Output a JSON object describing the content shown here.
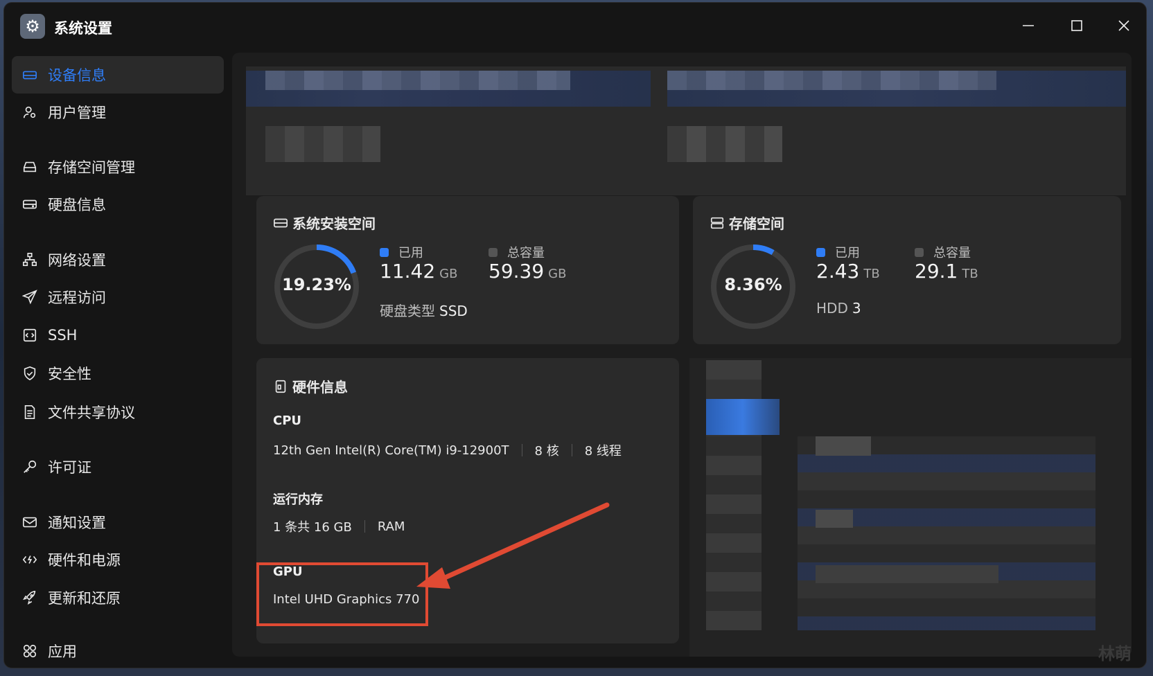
{
  "window": {
    "title": "系统设置"
  },
  "icons": {
    "app": "gear-icon",
    "minimize": "minimize-icon",
    "maximize": "maximize-icon",
    "close": "close-icon"
  },
  "sidebar": {
    "items": [
      {
        "label": "设备信息",
        "icon": "device-icon",
        "active": true
      },
      {
        "label": "用户管理",
        "icon": "user-icon"
      },
      {
        "label": "存储空间管理",
        "icon": "storage-icon"
      },
      {
        "label": "硬盘信息",
        "icon": "disk-icon"
      },
      {
        "label": "网络设置",
        "icon": "network-icon"
      },
      {
        "label": "远程访问",
        "icon": "send-icon"
      },
      {
        "label": "SSH",
        "icon": "ssh-icon"
      },
      {
        "label": "安全性",
        "icon": "shield-icon"
      },
      {
        "label": "文件共享协议",
        "icon": "file-icon"
      },
      {
        "label": "许可证",
        "icon": "key-icon"
      },
      {
        "label": "通知设置",
        "icon": "mail-icon"
      },
      {
        "label": "硬件和电源",
        "icon": "power-icon"
      },
      {
        "label": "更新和还原",
        "icon": "rocket-icon"
      },
      {
        "label": "应用",
        "icon": "apps-icon"
      }
    ]
  },
  "system_space": {
    "title": "系统安装空间",
    "percent_text": "19.23%",
    "percent": 19.23,
    "used_label": "已用",
    "used_value": "11.42",
    "used_unit": "GB",
    "total_label": "总容量",
    "total_value": "59.39",
    "total_unit": "GB",
    "disk_type_label": "硬盘类型",
    "disk_type_value": "SSD"
  },
  "storage_space": {
    "title": "存储空间",
    "percent_text": "8.36%",
    "percent": 8.36,
    "used_label": "已用",
    "used_value": "2.43",
    "used_unit": "TB",
    "total_label": "总容量",
    "total_value": "29.1",
    "total_unit": "TB",
    "disk_type_label": "HDD",
    "disk_type_value": "3"
  },
  "hardware": {
    "title": "硬件信息",
    "cpu_label": "CPU",
    "cpu_model": "12th Gen Intel(R) Core(TM) i9-12900T",
    "cpu_cores": "8 核",
    "cpu_threads": "8 线程",
    "ram_label": "运行内存",
    "ram_value": "1 条共 16 GB",
    "ram_type": "RAM",
    "gpu_label": "GPU",
    "gpu_value": "Intel UHD Graphics 770"
  },
  "colors": {
    "accent": "#2f7df6",
    "ring_bg": "#3f3f3f",
    "highlight": "#e04a33",
    "legend_total": "#555555"
  },
  "watermark": "林萌"
}
